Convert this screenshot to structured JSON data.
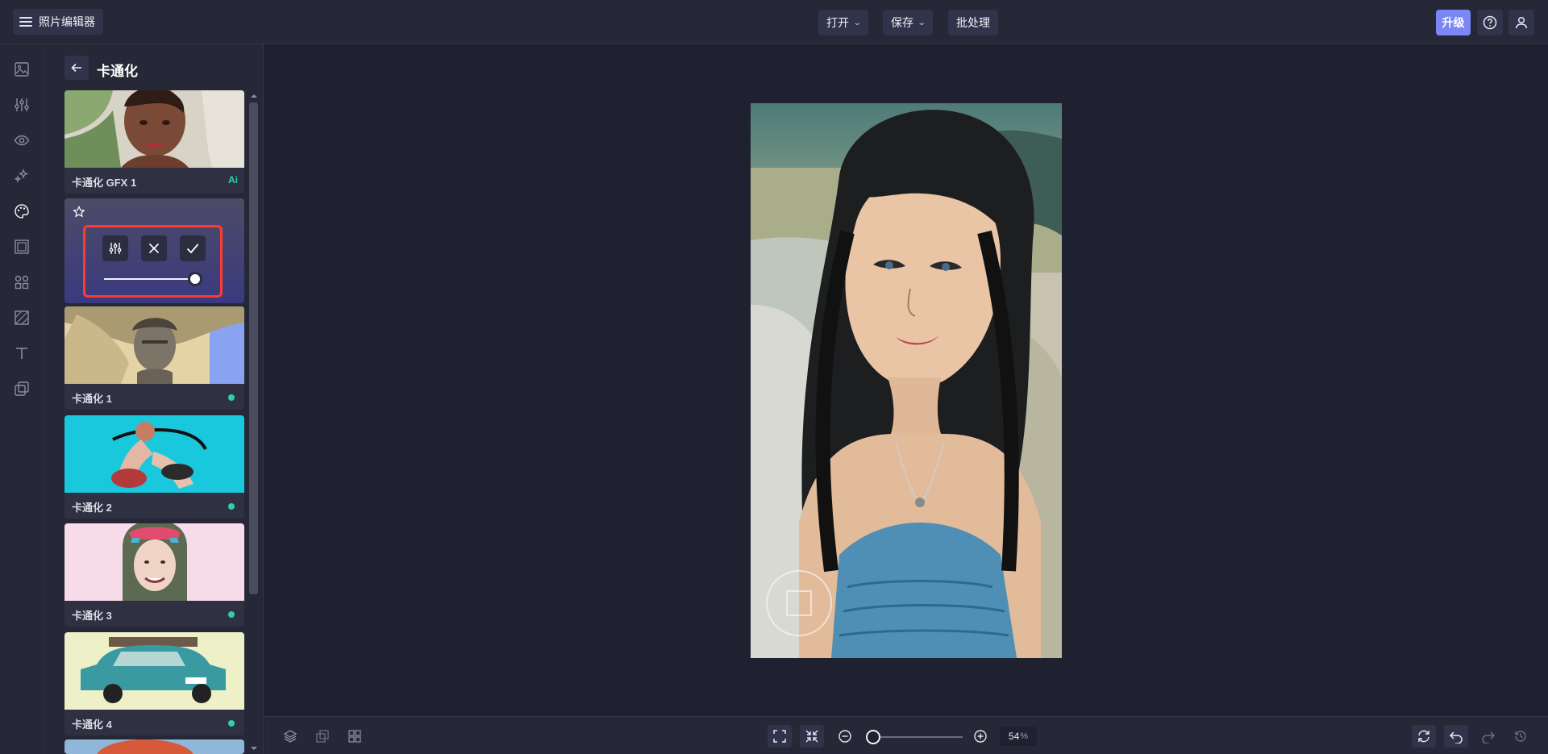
{
  "header": {
    "app_title": "照片编辑器",
    "menu_open": "打开",
    "menu_save": "保存",
    "menu_batch": "批处理",
    "upgrade": "升级"
  },
  "sidebar": {
    "icons": [
      "image-icon",
      "adjust-icon",
      "eye-icon",
      "sparkle-icon",
      "palette-icon",
      "frame-icon",
      "shapes-icon",
      "texture-icon",
      "text-icon",
      "overlay-icon"
    ],
    "active_index": 4
  },
  "panel": {
    "title": "卡通化",
    "cards": [
      {
        "label": "卡通化 GFX 1",
        "badge": "Ai"
      },
      {
        "label": "卡通化 1"
      },
      {
        "label": "卡通化 2"
      },
      {
        "label": "卡通化 3"
      },
      {
        "label": "卡通化 4"
      }
    ],
    "active_card": {
      "intensity": 100
    }
  },
  "bottom": {
    "zoom_value": "54",
    "zoom_unit": "%"
  },
  "colors": {
    "accent": "#7b87f4",
    "status_dot": "#2fd0a8",
    "highlight_border": "#ff3b2f"
  }
}
